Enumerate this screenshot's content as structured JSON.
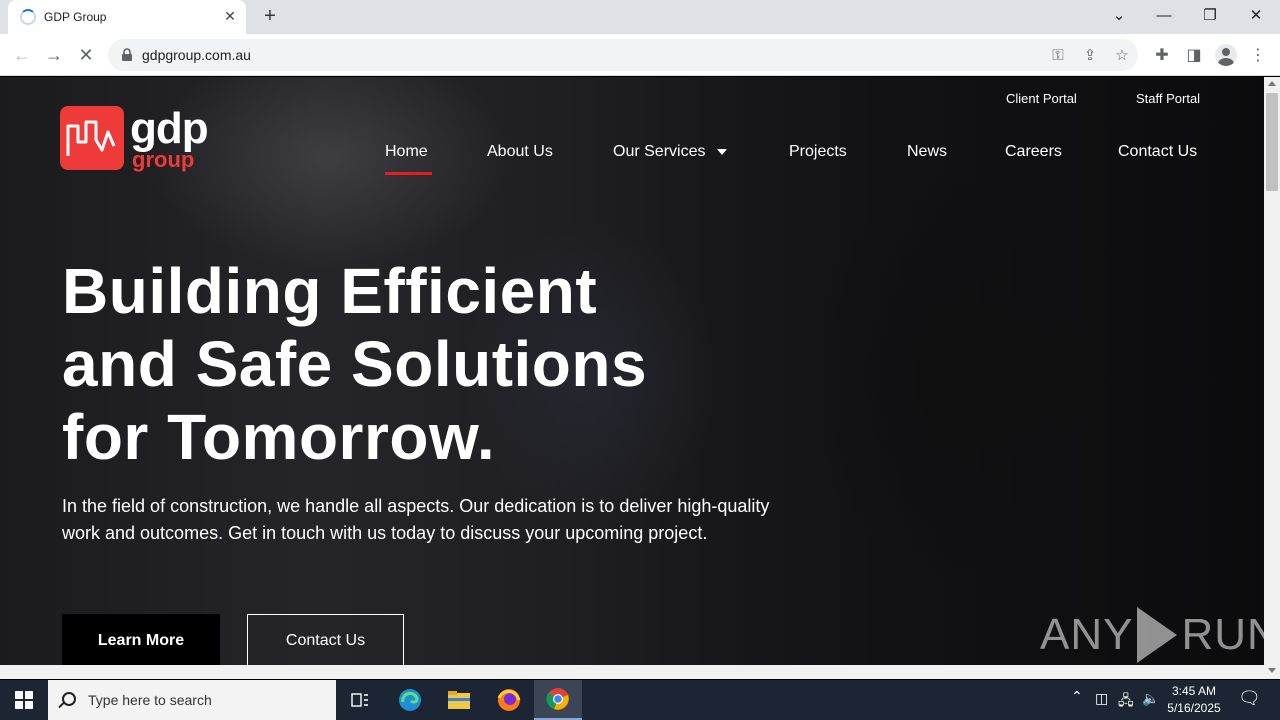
{
  "browser": {
    "tab_title": "GDP Group",
    "url": "gdpgroup.com.au"
  },
  "site": {
    "logo_text": "gdp",
    "logo_subtext": "group",
    "top_links": [
      "Client Portal",
      "Staff Portal"
    ],
    "nav": [
      {
        "label": "Home",
        "active": true
      },
      {
        "label": "About Us"
      },
      {
        "label": "Our Services",
        "dropdown": true
      },
      {
        "label": "Projects"
      },
      {
        "label": "News"
      },
      {
        "label": "Careers"
      },
      {
        "label": "Contact Us"
      }
    ],
    "headline": [
      "Building Efficient",
      "and Safe Solutions",
      "for Tomorrow."
    ],
    "subtext": "In the field of construction, we handle all aspects. Our dedication is to deliver high-quality work and outcomes. Get in touch with us today to discuss your upcoming project.",
    "buttons": {
      "primary": "Learn More",
      "secondary": "Contact Us"
    },
    "accent_color": "#ee3a39"
  },
  "watermark": {
    "left": "ANY",
    "right": "RUN"
  },
  "taskbar": {
    "search_placeholder": "Type here to search",
    "time": "3:45 AM",
    "date": "5/16/2025"
  }
}
